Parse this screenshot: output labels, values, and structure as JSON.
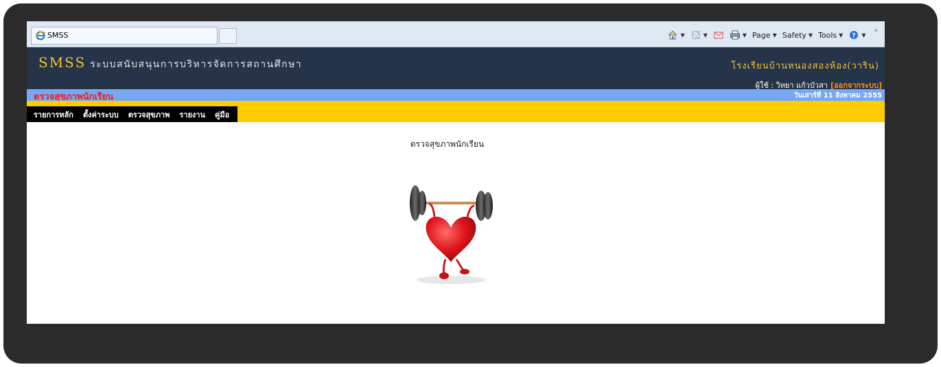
{
  "browser": {
    "tab_title": "SMSS",
    "toolbar": {
      "page_label": "Page",
      "safety_label": "Safety",
      "tools_label": "Tools",
      "more": "»"
    },
    "icons": [
      "ie-icon",
      "home-icon",
      "rss-icon",
      "mail-icon",
      "print-icon",
      "help-icon"
    ]
  },
  "header": {
    "brand": "SMSS",
    "subtitle": "ระบบสนับสนุนการบริหารจัดการสถานศึกษา",
    "school": "โรงเรียนบ้านหนองสองห้อง(วาริน)",
    "user_label": "ผู้ใช้ : วิทยา แก้วบัวสา",
    "logout_label": "[ออกจากระบบ]"
  },
  "titlebar": {
    "page_title": "ตรวจสุขภาพนักเรียน",
    "date": "วันเสาร์ที่ 11 สิงหาคม 2555"
  },
  "menu": {
    "items": [
      "รายการหลัก",
      "ตั้งค่าระบบ",
      "ตรวจสุขภาพ",
      "รายงาน",
      "คู่มือ"
    ]
  },
  "content": {
    "heading": "ตรวจสุขภาพนักเรียน",
    "image": "heart-lifting-barbell"
  },
  "colors": {
    "header_bg": "#263449",
    "accent_gold": "#f1c232",
    "titlebar_bg": "#78a7f4",
    "title_red": "#e8231b",
    "menubar_bg": "#ffcc00",
    "menu_bg": "#000000"
  }
}
